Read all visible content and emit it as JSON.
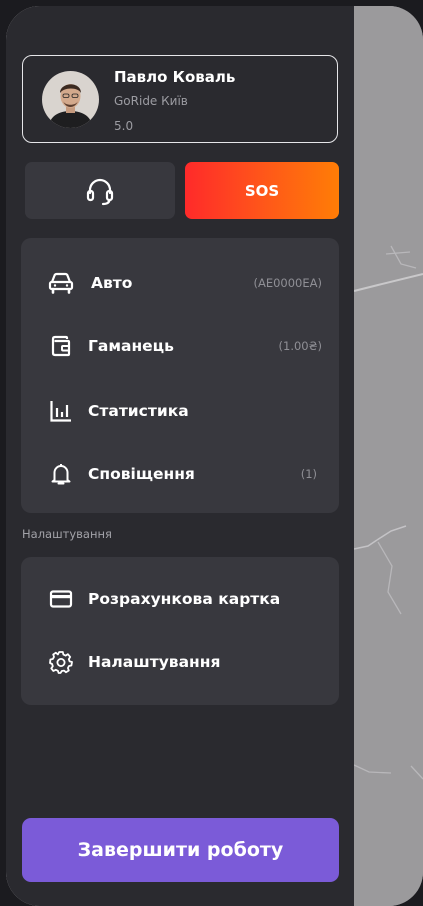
{
  "profile": {
    "name": "Павло Коваль",
    "company": "GoRide Київ",
    "rating": "5.0",
    "avatar_icon": "person-photo"
  },
  "actions": {
    "support_icon": "headset-icon",
    "sos_label": "SOS",
    "sos_colors": [
      "#ff2a2a",
      "#ff7d06"
    ]
  },
  "menu": {
    "items": [
      {
        "icon": "car-icon",
        "label": "Авто",
        "value": "(AE0000EA)"
      },
      {
        "icon": "wallet-icon",
        "label": "Гаманець",
        "value": "(1.00₴)"
      },
      {
        "icon": "bar-chart-icon",
        "label": "Статистика",
        "value": ""
      },
      {
        "icon": "bell-icon",
        "label": "Сповіщення",
        "value": "(1)"
      }
    ]
  },
  "settings_section": {
    "title": "Налаштування",
    "items": [
      {
        "icon": "credit-card-icon",
        "label": "Розрахункова картка"
      },
      {
        "icon": "gear-icon",
        "label": "Налаштування"
      }
    ]
  },
  "footer": {
    "finish_label": "Завершити роботу",
    "accent": "#7b5bd8"
  }
}
